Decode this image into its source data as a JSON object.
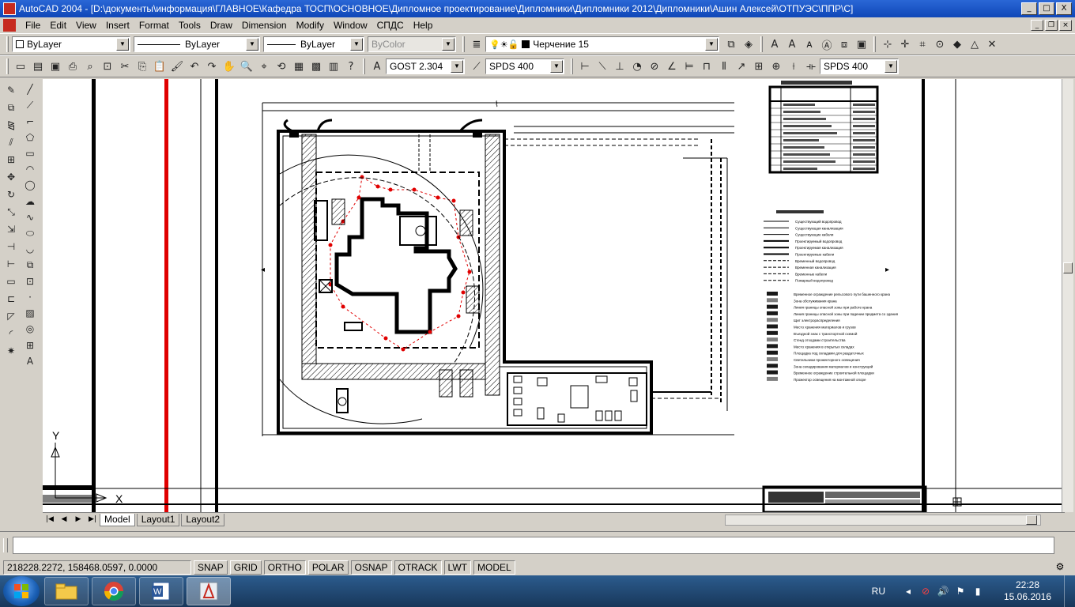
{
  "window": {
    "title": "AutoCAD 2004 - [D:\\документы\\информация\\ГЛАВНОЕ\\Кафедра ТОСП\\ОСНОВНОЕ\\Дипломное проектирование\\Дипломники\\Дипломники 2012\\Дипломники\\Ашин Алексей\\ОТПУЭС\\ППР\\С]",
    "min_glyph": "_",
    "max_glyph": "□",
    "close_glyph": "X"
  },
  "menu": {
    "items": [
      "File",
      "Edit",
      "View",
      "Insert",
      "Format",
      "Tools",
      "Draw",
      "Dimension",
      "Modify",
      "Window",
      "СПДС",
      "Help"
    ],
    "mdi_min": "_",
    "mdi_restore": "❐",
    "mdi_close": "×"
  },
  "properties": {
    "layer_color": "ByLayer",
    "linetype": "ByLayer",
    "lineweight": "ByLayer",
    "plotstyle": "ByColor",
    "current_layer": "Черчение 15"
  },
  "styles": {
    "text_style": "GOST 2.304",
    "dim_style": "SPDS 400",
    "dim_style_right": "SPDS 400"
  },
  "tabs": {
    "items": [
      "Model",
      "Layout1",
      "Layout2"
    ],
    "active": "Model"
  },
  "status": {
    "coords": "218228.2272, 158468.0597, 0.0000",
    "buttons": [
      "SNAP",
      "GRID",
      "ORTHO",
      "POLAR",
      "OSNAP",
      "OTRACK",
      "LWT",
      "MODEL"
    ]
  },
  "ucs": {
    "y_label": "Y",
    "x_label": "X"
  },
  "drawing": {
    "legend_rows": [
      "Существующий водопровод",
      "Существующая канализация",
      "Существующие кабели",
      "Проектируемый водопровод",
      "Проектируемая канализация",
      "Проектируемые кабели",
      "Временный водопровод",
      "Временная канализация",
      "Временные кабели",
      "Пожарный водопровод"
    ],
    "legend2_rows": [
      "Временное ограждение рельсового пути башенного крана",
      "Зона обслуживания крана",
      "Линия границы опасной зоны при работе крана",
      "Линия границы опасной зоны при падении предмета со здания",
      "Щит электрораспределения",
      "Место хранения материалов и грузов",
      "Въездной знак с транспортной схемой",
      "Стенд отходами строительства",
      "Место хранения в открытых складах",
      "Площадка под складами для раздаточных",
      "Светильники прожекторного освещения",
      "Зона складирования материалов и конструкций",
      "Временное ограждение строительной площадки",
      "Прожектор освещения на монтажной опоре"
    ]
  },
  "taskbar": {
    "lang": "RU",
    "time": "22:28",
    "date": "15.06.2016"
  }
}
